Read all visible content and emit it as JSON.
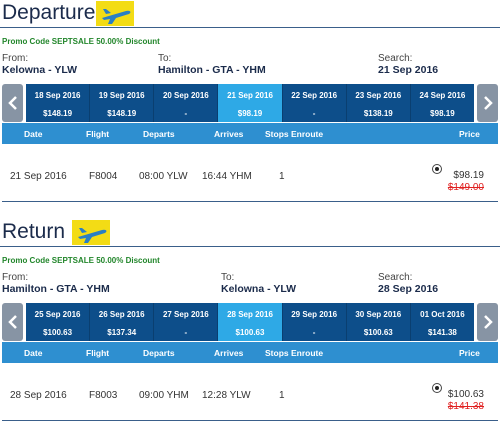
{
  "departure": {
    "title": "Departure",
    "promo": "Promo Code SEPTSALE 50.00% Discount",
    "from_label": "From:",
    "from_value": "Kelowna - YLW",
    "to_label": "To:",
    "to_value": "Hamilton - GTA - YHM",
    "search_label": "Search:",
    "search_value": "21 Sep 2016",
    "dates": [
      {
        "date": "18 Sep 2016",
        "price": "$148.19"
      },
      {
        "date": "19 Sep 2016",
        "price": "$148.19"
      },
      {
        "date": "20 Sep 2016",
        "price": "-"
      },
      {
        "date": "21 Sep 2016",
        "price": "$98.19"
      },
      {
        "date": "22 Sep 2016",
        "price": "-"
      },
      {
        "date": "23 Sep 2016",
        "price": "$138.19"
      },
      {
        "date": "24 Sep 2016",
        "price": "$98.19"
      }
    ],
    "columns": {
      "date": "Date",
      "flight": "Flight",
      "departs": "Departs",
      "arrives": "Arrives",
      "stops": "Stops Enroute",
      "price": "Price"
    },
    "row": {
      "date": "21 Sep 2016",
      "flight": "F8004",
      "departs": "08:00 YLW",
      "arrives": "16:44 YHM",
      "stops": "1",
      "price": "$98.19",
      "old_price": "$149.00"
    }
  },
  "return": {
    "title": "Return",
    "promo": "Promo Code SEPTSALE 50.00% Discount",
    "from_label": "From:",
    "from_value": "Hamilton - GTA - YHM",
    "to_label": "To:",
    "to_value": "Kelowna - YLW",
    "search_label": "Search:",
    "search_value": "28 Sep 2016",
    "dates": [
      {
        "date": "25 Sep 2016",
        "price": "$100.63"
      },
      {
        "date": "26 Sep 2016",
        "price": "$137.34"
      },
      {
        "date": "27 Sep 2016",
        "price": "-"
      },
      {
        "date": "28 Sep 2016",
        "price": "$100.63"
      },
      {
        "date": "29 Sep 2016",
        "price": "-"
      },
      {
        "date": "30 Sep 2016",
        "price": "$100.63"
      },
      {
        "date": "01 Oct 2016",
        "price": "$141.38"
      }
    ],
    "columns": {
      "date": "Date",
      "flight": "Flight",
      "departs": "Departs",
      "arrives": "Arrives",
      "stops": "Stops Enroute",
      "price": "Price"
    },
    "row": {
      "date": "28 Sep 2016",
      "flight": "F8003",
      "departs": "09:00 YHM",
      "arrives": "12:28 YLW",
      "stops": "1",
      "price": "$100.63",
      "old_price": "$141.38"
    }
  },
  "colors": {
    "accent_dark": "#0d4e8a",
    "accent_selected": "#2ea9e6",
    "header_bar": "#2e8fd0",
    "promo": "#22862b",
    "old_price": "#e02020",
    "plane_bg": "#f3dc15"
  },
  "icons": {
    "plane": "airplane-icon",
    "prev": "chevron-left-icon",
    "next": "chevron-right-icon"
  }
}
